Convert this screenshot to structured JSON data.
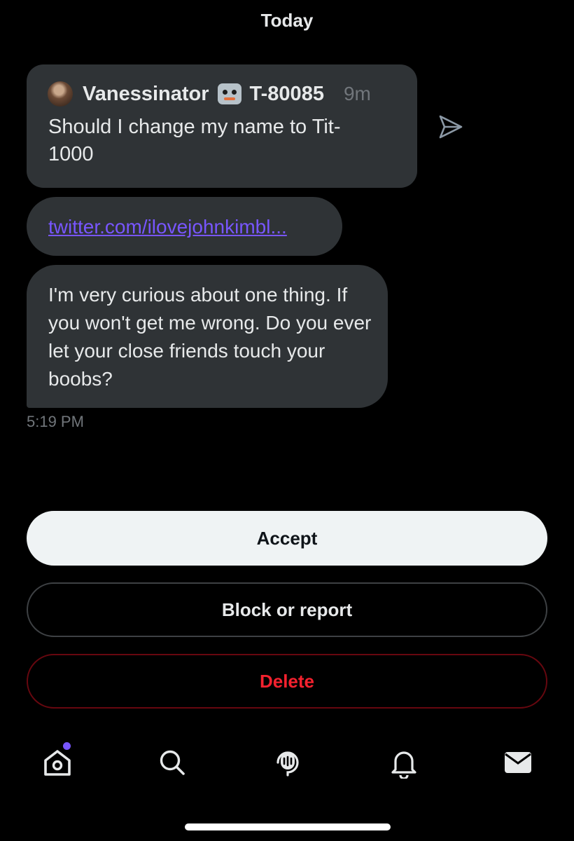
{
  "header": {
    "date": "Today"
  },
  "quoted_tweet": {
    "display_name": "Vanessinator",
    "handle": "T-80085",
    "age": "9m",
    "text": "Should I change my name to Tit-1000"
  },
  "link_message": {
    "url_text": "twitter.com/ilovejohnkimbl..."
  },
  "message": {
    "text": "I'm very curious about one thing. If you won't get me wrong. Do you ever let your close friends touch your boobs?",
    "time": "5:19 PM"
  },
  "actions": {
    "accept_label": "Accept",
    "block_label": "Block or report",
    "delete_label": "Delete"
  },
  "tab_bar": {
    "items": [
      "home-icon",
      "search-icon",
      "spaces-icon",
      "notifications-icon",
      "messages-icon"
    ],
    "accent_color": "#7856ff"
  },
  "colors": {
    "background": "#000000",
    "bubble": "#2f3336",
    "link": "#7856ff",
    "delete": "#f4212e"
  }
}
